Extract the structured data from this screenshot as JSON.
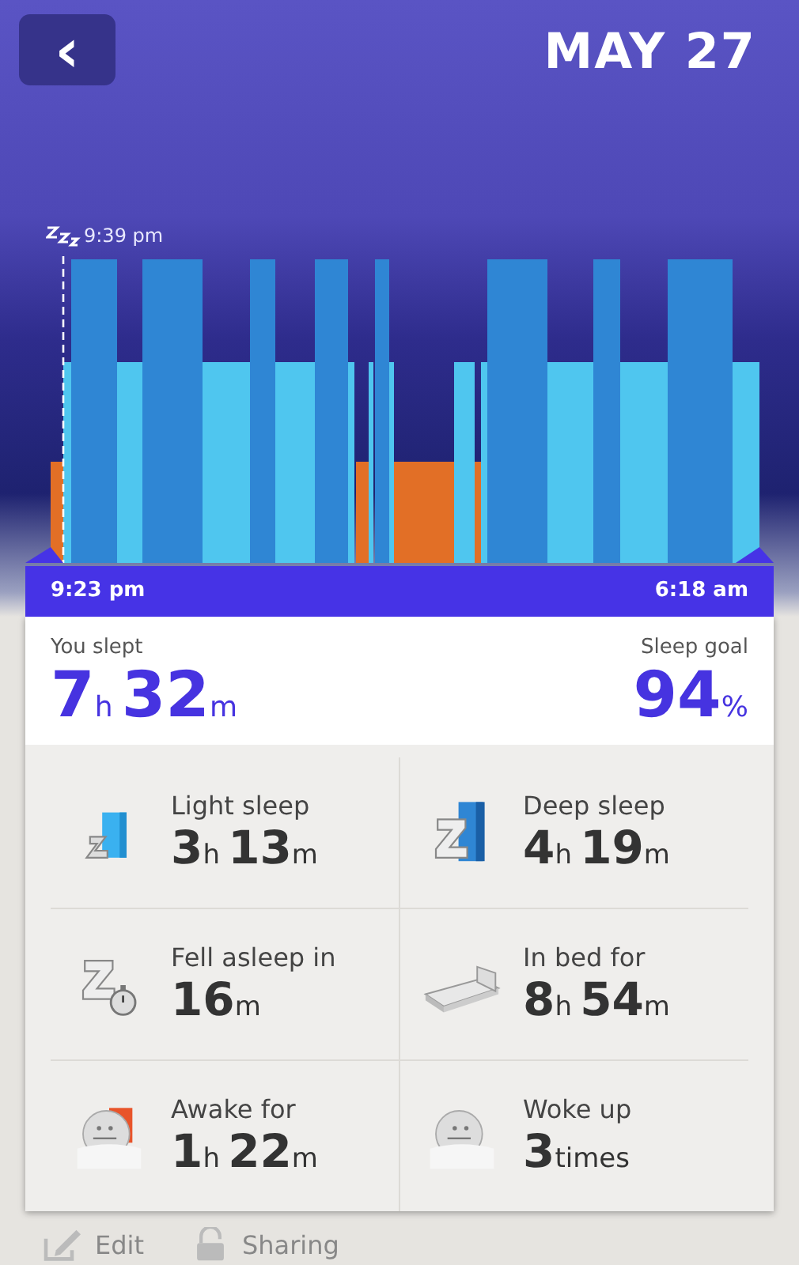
{
  "header": {
    "back": "‹",
    "title": "MAY 27"
  },
  "chart": {
    "onset": "9:39 pm",
    "start": "9:23 pm",
    "end": "6:18 am"
  },
  "summary": {
    "slept_label": "You slept",
    "slept": [
      {
        "n": "7",
        "u": "h"
      },
      {
        "n": "32",
        "u": "m"
      }
    ],
    "goal_label": "Sleep goal",
    "goal": [
      {
        "n": "94",
        "u": "%"
      }
    ]
  },
  "stats": [
    {
      "kind": "light",
      "label": "Light sleep",
      "value": [
        {
          "n": "3",
          "u": "h"
        },
        {
          "n": "13",
          "u": "m"
        }
      ]
    },
    {
      "kind": "deep",
      "label": "Deep sleep",
      "value": [
        {
          "n": "4",
          "u": "h"
        },
        {
          "n": "19",
          "u": "m"
        }
      ]
    },
    {
      "kind": "fell",
      "label": "Fell asleep in",
      "value": [
        {
          "n": "16",
          "u": "m"
        }
      ]
    },
    {
      "kind": "bed",
      "label": "In bed for",
      "value": [
        {
          "n": "8",
          "u": "h"
        },
        {
          "n": "54",
          "u": "m"
        }
      ]
    },
    {
      "kind": "awake",
      "label": "Awake for",
      "value": [
        {
          "n": "1",
          "u": "h"
        },
        {
          "n": "22",
          "u": "m"
        }
      ]
    },
    {
      "kind": "woke",
      "label": "Woke up",
      "value": [
        {
          "n": "3",
          "u": "times"
        }
      ]
    }
  ],
  "footer": [
    {
      "kind": "edit",
      "label": "Edit"
    },
    {
      "kind": "sharing",
      "label": "Sharing"
    }
  ]
}
